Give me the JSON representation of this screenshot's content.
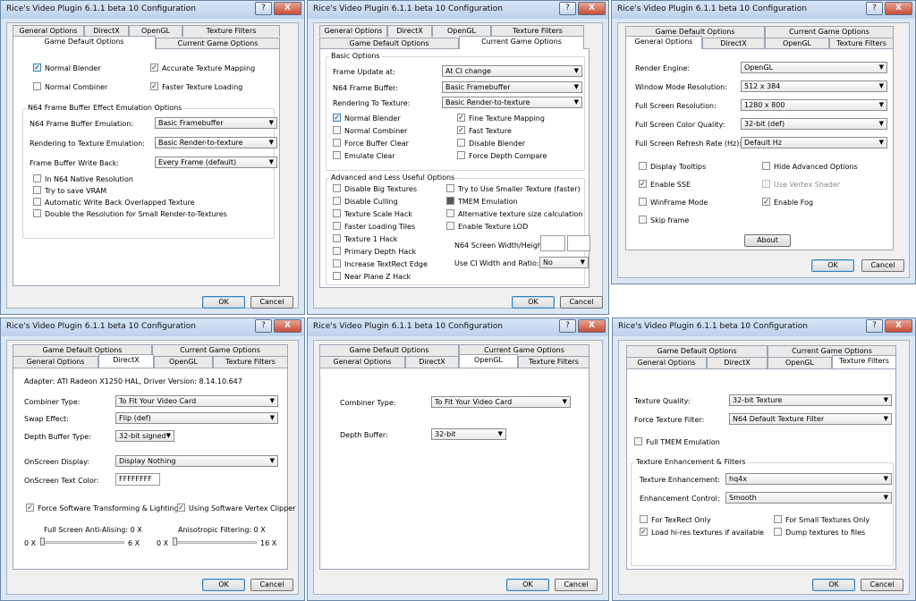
{
  "title": "Rice's Video Plugin 6.1.1 beta 10 Configuration",
  "titlebar_help": "?",
  "titlebar_close": "X",
  "dropdown_arrow": "▼",
  "check": "✓",
  "ok": "OK",
  "cancel": "Cancel",
  "tabs": {
    "general": "General Options",
    "directx": "DirectX",
    "opengl": "OpenGL",
    "texture": "Texture Filters",
    "game_default": "Game Default Options",
    "current_game": "Current Game Options"
  },
  "w1": {
    "normal_blender": "Normal Blender",
    "accurate_texture": "Accurate Texture Mapping",
    "normal_combiner": "Normal Combiner",
    "faster_loading": "Faster Texture Loading",
    "fb_group": "N64 Frame Buffer Effect Emulation Options",
    "fb_emulation_label": "N64 Frame Buffer Emulation:",
    "fb_emulation_value": "Basic Framebuffer",
    "rtt_label": "Rendering to Texture Emulation:",
    "rtt_value": "Basic Render-to-texture",
    "writeback_label": "Frame Buffer Write Back:",
    "writeback_value": "Every Frame (default)",
    "n64_native": "In N64 Native Resolution",
    "save_vram": "Try to save VRAM",
    "auto_writeback": "Automatic Write Back Overlapped Texture",
    "double_res": "Double the Resolution for Small Render-to-Textures"
  },
  "w2": {
    "basic_group": "Basic Options",
    "frame_update_label": "Frame Update at:",
    "frame_update_value": "At CI change",
    "n64_fb_label": "N64 Frame Buffer:",
    "n64_fb_value": "Basic Framebuffer",
    "rtt_label": "Rendering To Texture:",
    "rtt_value": "Basic Render-to-texture",
    "normal_blender": "Normal Blender",
    "fine_texture": "Fine Texture Mapping",
    "normal_combiner": "Normal Combiner",
    "fast_texture": "Fast Texture",
    "force_buffer_clear": "Force Buffer Clear",
    "disable_blender": "Disable Blender",
    "emulate_clear": "Emulate Clear",
    "force_depth": "Force Depth Compare",
    "adv_group": "Advanced and Less Useful Options",
    "disable_big": "Disable Big Textures",
    "smaller_texture": "Try to Use Smaller Texture (faster)",
    "disable_culling": "Disable Culling",
    "tmem_emulation": "TMEM Emulation",
    "texture_scale": "Texture Scale Hack",
    "alt_texture_size": "Alternative texture size calculation",
    "faster_loading_tiles": "Faster Loading Tiles",
    "enable_lod": "Enable Texture LOD",
    "texture1_hack": "Texture 1 Hack",
    "screen_wh_label": "N64 Screen Width/Height:",
    "primary_depth": "Primary Depth Hack",
    "ci_width_label": "Use CI Width and Ratio:",
    "ci_width_value": "No",
    "increase_textrect": "Increase TextRect Edge",
    "near_plane": "Near Plane Z Hack"
  },
  "w3": {
    "render_engine_label": "Render Engine:",
    "render_engine_value": "OpenGL",
    "window_res_label": "Window Mode Resolution:",
    "window_res_value": "512 x 384",
    "fullscreen_res_label": "Full Screen Resolution:",
    "fullscreen_res_value": "1280 x 800",
    "color_quality_label": "Full Screen Color Quality:",
    "color_quality_value": "32-bit (def)",
    "refresh_label": "Full Screen Refresh Rate (Hz):",
    "refresh_value": "Default Hz",
    "display_tooltips": "Display Tooltips",
    "hide_advanced": "Hide Advanced Options",
    "enable_sse": "Enable SSE",
    "vertex_shader": "Use Vertex Shader",
    "winframe": "WinFrame Mode",
    "enable_fog": "Enable Fog",
    "skip_frame": "Skip frame",
    "about": "About"
  },
  "w4": {
    "adapter": "Adapter: ATI Radeon X1250  HAL, Driver Version: 8.14.10.647",
    "combiner_label": "Combiner Type:",
    "combiner_value": "To Fit Your Video Card",
    "swap_label": "Swap Effect:",
    "swap_value": "Flip (def)",
    "depth_label": "Depth Buffer Type:",
    "depth_value": "32-bit signed",
    "osd_label": "OnScreen Display:",
    "osd_value": "Display Nothing",
    "osd_color_label": "OnScreen Text Color:",
    "osd_color_value": "FFFFFFFF",
    "force_sw_tl": "Force Software Transforming & Lighting",
    "sw_vertex_clipper": "Using Software Vertex Clipper",
    "aa_label": "Full Screen Anti-Alising: 0 X",
    "aniso_label": "Anisotropic Filtering: 0 X",
    "aa_min": "0 X",
    "aa_max": "6 X",
    "aniso_min": "0 X",
    "aniso_max": "16 X",
    "aa_level": 0,
    "aniso_level": 0
  },
  "w5": {
    "combiner_label": "Combiner Type:",
    "combiner_value": "To Fit Your Video Card",
    "depth_label": "Depth Buffer:",
    "depth_value": "32-bit"
  },
  "w6": {
    "quality_label": "Texture Quality:",
    "quality_value": "32-bit Texture",
    "force_filter_label": "Force Texture Filter:",
    "force_filter_value": "N64 Default Texture Filter",
    "full_tmem": "Full TMEM Emulation",
    "enh_group": "Texture Enhancement & Filters",
    "enhancement_label": "Texture Enhancement:",
    "enhancement_value": "hq4x",
    "enh_control_label": "Enhancement Control:",
    "enh_control_value": "Smooth",
    "for_texrect": "For TexRect Only",
    "for_small": "For Small Textures Only",
    "load_hires": "Load hi-res textures if available",
    "dump_textures": "Dump textures to files"
  }
}
